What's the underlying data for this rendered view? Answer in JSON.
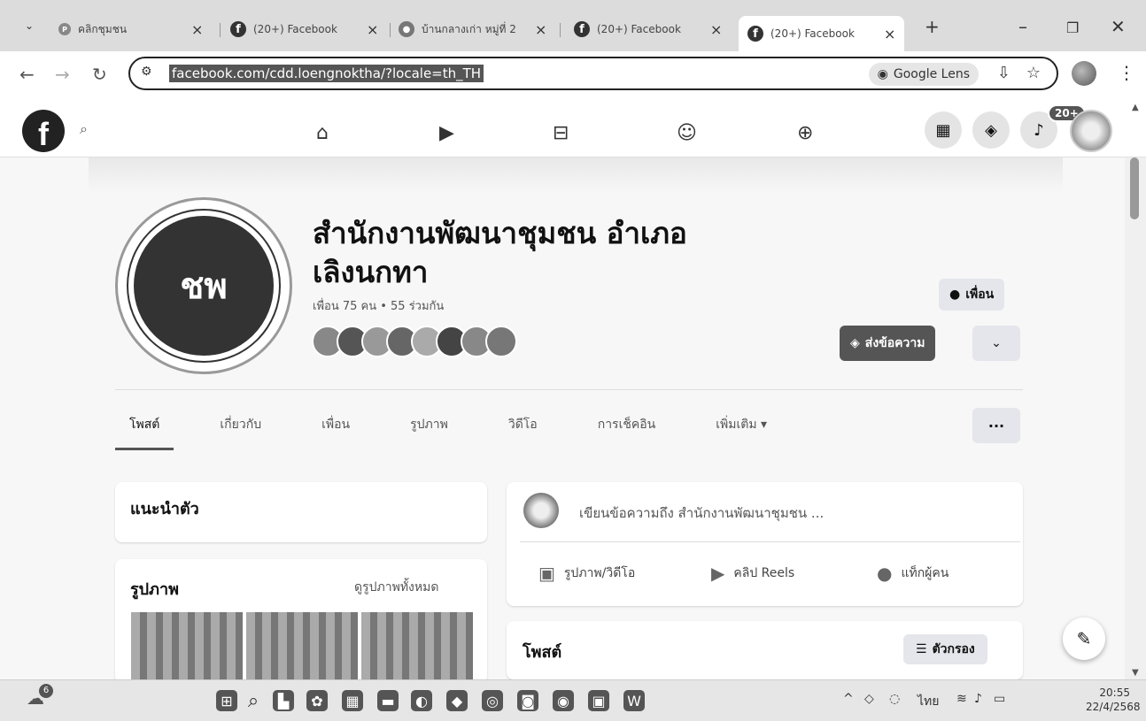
{
  "browser": {
    "tabs": [
      {
        "title": "คลิกชุมชน",
        "favicon": "page-icon",
        "active": false
      },
      {
        "title": "(20+) Facebook",
        "favicon": "facebook-icon",
        "active": false
      },
      {
        "title": "บ้านกลางเก่า หมู่ที่ 2",
        "favicon": "globe-icon",
        "active": false
      },
      {
        "title": "(20+) Facebook",
        "favicon": "facebook-icon",
        "active": false
      },
      {
        "title": "(20+) Facebook",
        "favicon": "facebook-icon",
        "active": true
      }
    ],
    "new_tab": "+",
    "url": "facebook.com/cdd.loengnoktha/?locale=th_TH",
    "lens_label": "Google Lens"
  },
  "fb_header": {
    "logo": "f",
    "notification_badge": "20+"
  },
  "profile": {
    "name": "สำนักงานพัฒนาชุมชน อำเภอ เลิงนกทา",
    "friends_summary": "เพื่อน 75 คน • 55 ร่วมกัน",
    "friend_button": "เพื่อน",
    "message_button": "ส่งข้อความ",
    "logo_text": "ชพ"
  },
  "tabs": {
    "items": [
      "โพสต์",
      "เกี่ยวกับ",
      "เพื่อน",
      "รูปภาพ",
      "วิดีโอ",
      "การเช็คอิน",
      "เพิ่มเติม ▾"
    ],
    "active": "โพสต์",
    "more_dots": "···"
  },
  "left": {
    "intro_title": "แนะนำตัว",
    "photos_title": "รูปภาพ",
    "see_all_photos": "ดูรูปภาพทั้งหมด"
  },
  "composer": {
    "placeholder": "เขียนข้อความถึง สำนักงานพัฒนาชุมชน ...",
    "photo_video": "รูปภาพ/วิดีโอ",
    "reels": "คลิป Reels",
    "tag_people": "แท็กผู้คน"
  },
  "posts": {
    "title": "โพสต์",
    "filter": "ตัวกรอง"
  },
  "taskbar": {
    "weather_badge": "6",
    "lang": "ไทย",
    "time": "20:55",
    "date": "22/4/2568"
  }
}
